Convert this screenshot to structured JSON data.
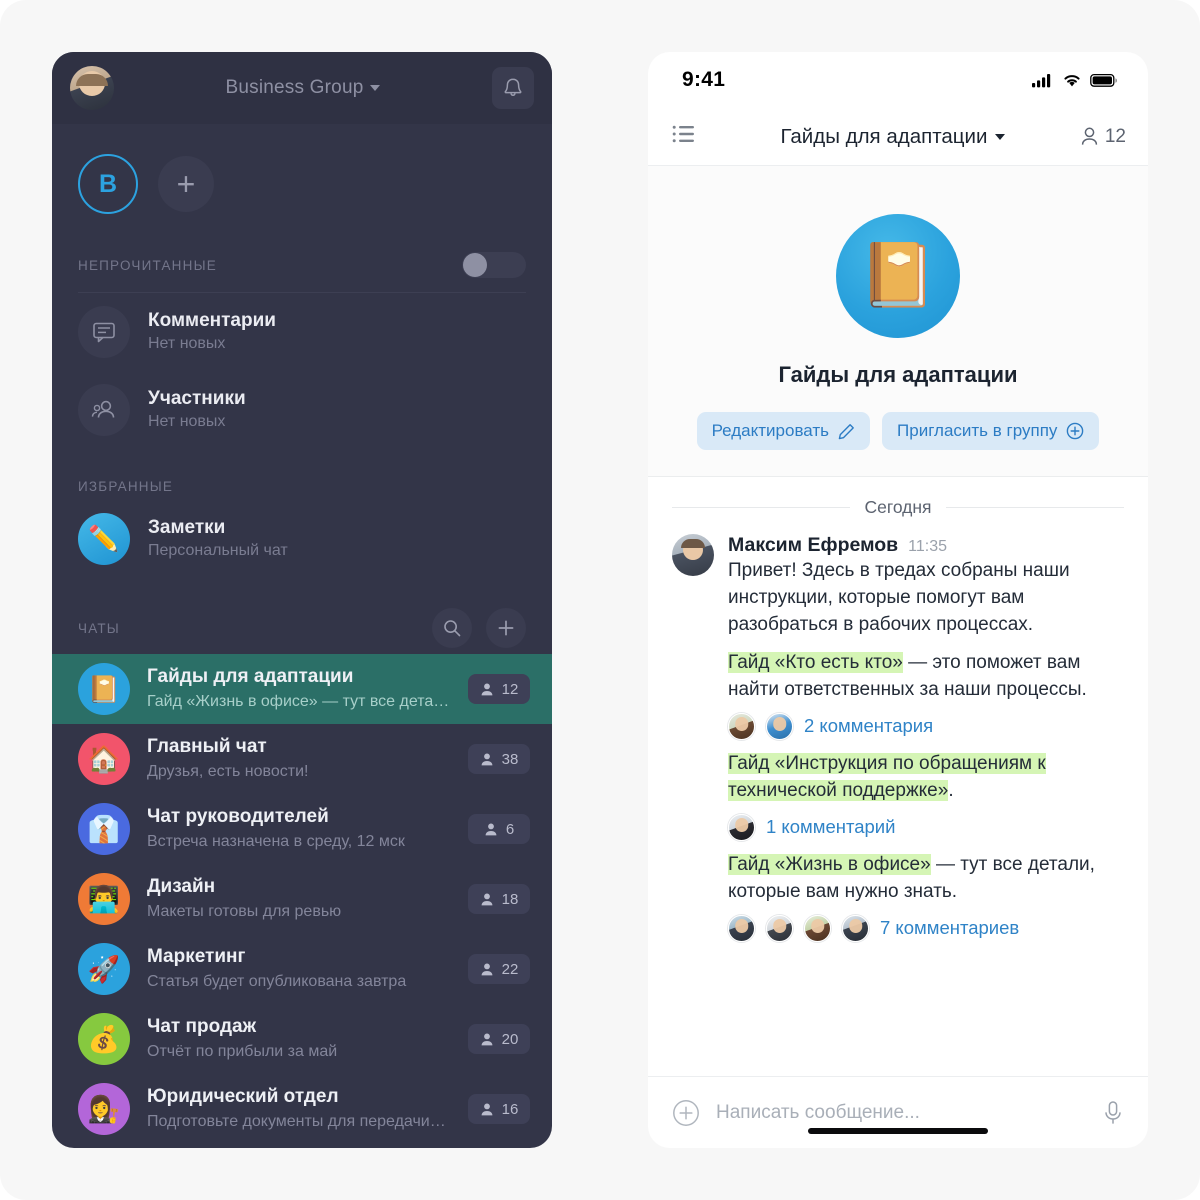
{
  "sidebar": {
    "header": {
      "avatar": "user-photo",
      "title": "Business Group",
      "bell_icon": "bell-icon"
    },
    "team": {
      "active_initial": "B",
      "add_label": "+"
    },
    "unread": {
      "label": "НЕПРОЧИТАННЫЕ",
      "toggle_state": "off"
    },
    "quick_items": [
      {
        "title": "Комментарии",
        "subtitle": "Нет новых",
        "icon": "comment-bubble-icon"
      },
      {
        "title": "Участники",
        "subtitle": "Нет новых",
        "icon": "people-icon"
      }
    ],
    "favorites_label": "ИЗБРАННЫЕ",
    "favorites": [
      {
        "title": "Заметки",
        "subtitle": "Персональный чат",
        "emoji": "✏️"
      }
    ],
    "chats_label": "ЧАТЫ",
    "chats_actions": {
      "search_icon": "search-icon",
      "add_icon": "plus-icon"
    },
    "chats": [
      {
        "name": "Гайды для адаптации",
        "preview": "Гайд «Жизнь в офисе» — тут все детали…",
        "count": "12",
        "emoji": "📔",
        "avatar_color": "#2ba2dd",
        "active": true
      },
      {
        "name": "Главный чат",
        "preview": "Друзья, есть новости!",
        "count": "38",
        "emoji": "🏠",
        "avatar_color": "#f2546b",
        "active": false
      },
      {
        "name": "Чат руководителей",
        "preview": "Встреча назначена в среду, 12 мск",
        "count": "6",
        "emoji": "👔",
        "avatar_color": "#4a6ae0",
        "active": false
      },
      {
        "name": "Дизайн",
        "preview": "Макеты готовы для ревью",
        "count": "18",
        "emoji": "👨‍💻",
        "avatar_color": "#ef7a36",
        "active": false
      },
      {
        "name": "Маркетинг",
        "preview": "Статья будет опубликована завтра",
        "count": "22",
        "emoji": "🚀",
        "avatar_color": "#2ba2dd",
        "active": false
      },
      {
        "name": "Чат продаж",
        "preview": "Отчёт по прибыли за май",
        "count": "20",
        "emoji": "💰",
        "avatar_color": "#86c93f",
        "active": false
      },
      {
        "name": "Юридический отдел",
        "preview": "Подготовьте документы для передачи…",
        "count": "16",
        "emoji": "👩‍⚖️",
        "avatar_color": "#b366d9",
        "active": false
      }
    ]
  },
  "phone": {
    "statusbar": {
      "time": "9:41",
      "cellular_icon": "cellular-signal-icon",
      "wifi_icon": "wifi-icon",
      "battery_icon": "battery-full-icon"
    },
    "topbar": {
      "menu_icon": "list-menu-icon",
      "title": "Гайды для адаптации",
      "members_count": "12",
      "members_icon": "person-icon"
    },
    "group_card": {
      "emoji": "📔",
      "name": "Гайды для адаптации",
      "edit_label": "Редактировать",
      "edit_icon": "pencil-icon",
      "invite_label": "Пригласить в группу",
      "invite_icon": "plus-circle-icon"
    },
    "conversation": {
      "day_label": "Сегодня",
      "message": {
        "author": "Максим Ефремов",
        "time": "11:35",
        "intro": "Привет! Здесь в тредах собраны наши инструкции, которые помогут вам разобраться в рабочих процессах.",
        "threads": [
          {
            "highlight": "Гайд «Кто есть кто»",
            "rest": " — это поможет вам найти ответственных за наши процессы.",
            "comments_label": "2 комментария",
            "avatars": [
              "c1",
              "c2"
            ]
          },
          {
            "highlight": "Гайд «Инструкция по обращениям к технической поддержке»",
            "rest": ".",
            "comments_label": "1 комментарий",
            "avatars": [
              "c3"
            ]
          },
          {
            "highlight": "Гайд «Жизнь в офисе»",
            "rest": " — тут все детали, которые вам нужно знать.",
            "comments_label": "7 комментариев",
            "avatars": [
              "c4",
              "c5",
              "c6",
              "c7"
            ]
          }
        ]
      }
    },
    "composer": {
      "add_icon": "plus-circle-icon",
      "placeholder": "Написать сообщение...",
      "mic_icon": "microphone-icon"
    }
  },
  "colors": {
    "sidebar_bg": "#333548",
    "sidebar_header_bg": "#2f3143",
    "active_chat_bg": "#2b6f67",
    "accent_blue": "#2ba2dd",
    "link_blue": "#2f83c7",
    "highlight_green": "#d5f5b5",
    "pill_bg": "#d9e9f7",
    "canvas_bg": "#f7f7f7"
  }
}
